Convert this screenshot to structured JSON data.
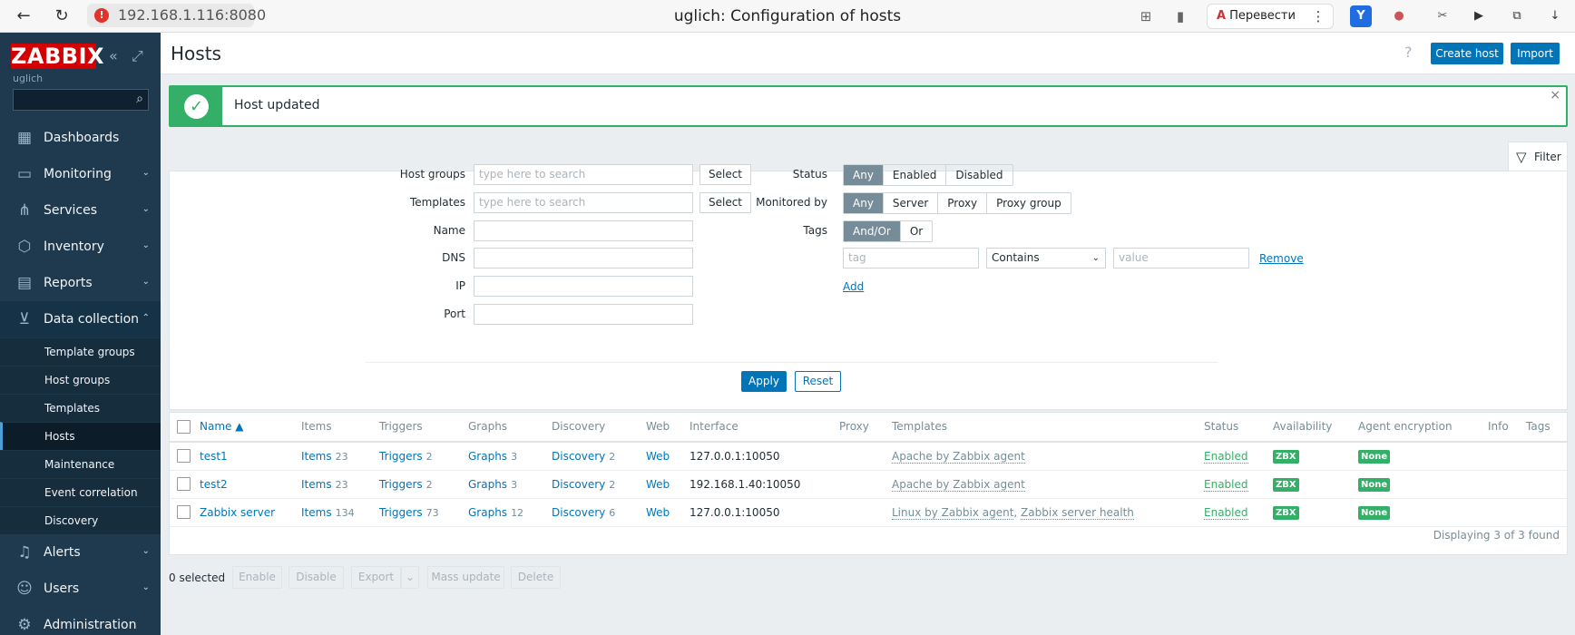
{
  "browser": {
    "address": "192.168.1.116:8080",
    "tab_title": "uglich: Configuration of hosts",
    "translate_label": "Перевести"
  },
  "sidebar": {
    "logo": "ZABBIX",
    "server_name": "uglich",
    "search_placeholder": "",
    "items": [
      {
        "label": "Dashboards",
        "icon": "dashboards-icon"
      },
      {
        "label": "Monitoring",
        "icon": "monitoring-icon"
      },
      {
        "label": "Services",
        "icon": "services-icon"
      },
      {
        "label": "Inventory",
        "icon": "inventory-icon"
      },
      {
        "label": "Reports",
        "icon": "reports-icon"
      },
      {
        "label": "Data collection",
        "icon": "data-collection-icon"
      },
      {
        "label": "Alerts",
        "icon": "alerts-icon"
      },
      {
        "label": "Users",
        "icon": "users-icon"
      },
      {
        "label": "Administration",
        "icon": "administration-icon"
      }
    ],
    "sub_items": [
      "Template groups",
      "Host groups",
      "Templates",
      "Hosts",
      "Maintenance",
      "Event correlation",
      "Discovery"
    ],
    "active_sub": "Hosts"
  },
  "header": {
    "title": "Hosts",
    "help": "?",
    "create_host": "Create host",
    "import": "Import"
  },
  "message": {
    "text": "Host updated",
    "close": "×"
  },
  "filter": {
    "tab_label": "Filter",
    "host_groups_label": "Host groups",
    "templates_label": "Templates",
    "name_label": "Name",
    "dns_label": "DNS",
    "ip_label": "IP",
    "port_label": "Port",
    "search_placeholder": "type here to search",
    "select_label": "Select",
    "status_label": "Status",
    "status_options": [
      "Any",
      "Enabled",
      "Disabled"
    ],
    "monitored_by_label": "Monitored by",
    "monitored_by_options": [
      "Any",
      "Server",
      "Proxy",
      "Proxy group"
    ],
    "tags_label": "Tags",
    "tags_options": [
      "And/Or",
      "Or"
    ],
    "tag_placeholder": "tag",
    "operator": "Contains",
    "value_placeholder": "value",
    "remove": "Remove",
    "add": "Add",
    "apply": "Apply",
    "reset": "Reset"
  },
  "table": {
    "columns": [
      "Name ▲",
      "Items",
      "Triggers",
      "Graphs",
      "Discovery",
      "Web",
      "Interface",
      "Proxy",
      "Templates",
      "Status",
      "Availability",
      "Agent encryption",
      "Info",
      "Tags"
    ],
    "rows": [
      {
        "name": "test1",
        "items": "Items",
        "items_n": "23",
        "triggers": "Triggers",
        "triggers_n": "2",
        "graphs": "Graphs",
        "graphs_n": "3",
        "discovery": "Discovery",
        "discovery_n": "2",
        "web": "Web",
        "interface": "127.0.0.1:10050",
        "templates": [
          "Apache by Zabbix agent"
        ],
        "status": "Enabled",
        "availability": "ZBX",
        "encryption": "None"
      },
      {
        "name": "test2",
        "items": "Items",
        "items_n": "23",
        "triggers": "Triggers",
        "triggers_n": "2",
        "graphs": "Graphs",
        "graphs_n": "3",
        "discovery": "Discovery",
        "discovery_n": "2",
        "web": "Web",
        "interface": "192.168.1.40:10050",
        "templates": [
          "Apache by Zabbix agent"
        ],
        "status": "Enabled",
        "availability": "ZBX",
        "encryption": "None"
      },
      {
        "name": "Zabbix server",
        "items": "Items",
        "items_n": "134",
        "triggers": "Triggers",
        "triggers_n": "73",
        "graphs": "Graphs",
        "graphs_n": "12",
        "discovery": "Discovery",
        "discovery_n": "6",
        "web": "Web",
        "interface": "127.0.0.1:10050",
        "templates": [
          "Linux by Zabbix agent",
          "Zabbix server health"
        ],
        "status": "Enabled",
        "availability": "ZBX",
        "encryption": "None"
      }
    ],
    "displaying": "Displaying 3 of 3 found"
  },
  "mass_actions": {
    "selected": "0 selected",
    "enable": "Enable",
    "disable": "Disable",
    "export": "Export",
    "mass_update": "Mass update",
    "delete": "Delete"
  }
}
